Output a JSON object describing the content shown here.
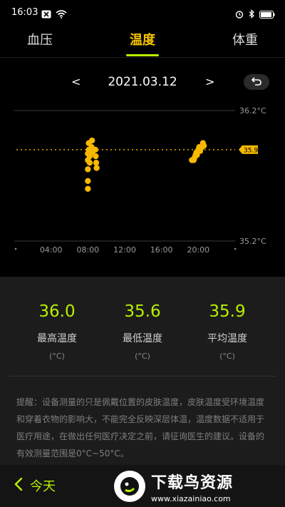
{
  "status_bar": {
    "time": "16:03"
  },
  "tabs": [
    {
      "label": "血压",
      "active": false
    },
    {
      "label": "温度",
      "active": true
    },
    {
      "label": "体重",
      "active": false
    }
  ],
  "date_nav": {
    "prev": "<",
    "date": "2021.03.12",
    "next": ">"
  },
  "chart_data": {
    "type": "scatter",
    "x_ticks": [
      "04:00",
      "08:00",
      "12:00",
      "16:00",
      "20:00"
    ],
    "y_max_label": "36.2°C",
    "y_min_label": "35.2°C",
    "ylim": [
      35.2,
      36.2
    ],
    "xlim": [
      0,
      24
    ],
    "average_label": "35.9",
    "average": 35.9,
    "accent_color": "#f6b800",
    "series": [
      {
        "points": [
          [
            8.0,
            35.75
          ],
          [
            8.0,
            35.66
          ],
          [
            8.0,
            35.6
          ],
          [
            8.0,
            35.82
          ],
          [
            8.0,
            35.87
          ],
          [
            8.1,
            35.9
          ],
          [
            8.1,
            35.95
          ],
          [
            8.2,
            35.85
          ],
          [
            8.2,
            35.8
          ],
          [
            8.4,
            35.92
          ],
          [
            8.45,
            35.97
          ],
          [
            8.5,
            35.88
          ],
          [
            8.8,
            35.9
          ],
          [
            8.85,
            35.85
          ],
          [
            8.9,
            35.8
          ],
          [
            8.95,
            35.76
          ],
          [
            19.3,
            35.82
          ],
          [
            19.5,
            35.82
          ],
          [
            19.6,
            35.84
          ],
          [
            19.7,
            35.86
          ],
          [
            19.8,
            35.88
          ],
          [
            19.85,
            35.86
          ],
          [
            20.0,
            35.9
          ],
          [
            20.1,
            35.92
          ],
          [
            20.2,
            35.89
          ],
          [
            20.4,
            35.92
          ],
          [
            20.5,
            35.95
          ],
          [
            20.6,
            35.93
          ]
        ]
      }
    ]
  },
  "stats": [
    {
      "value": "36.0",
      "label": "最高温度",
      "unit": "(°C)"
    },
    {
      "value": "35.6",
      "label": "最低温度",
      "unit": "(°C)"
    },
    {
      "value": "35.9",
      "label": "平均温度",
      "unit": "(°C)"
    }
  ],
  "notice": "提醒：设备测量的只是佩戴位置的皮肤温度，皮肤温度受环境温度和穿着衣物的影响大，不能完全反映深层体温，温度数据不适用于医疗用途，在做出任何医疗决定之前，请征询医生的建议。设备的有效测量范围是0°C~50°C。",
  "bottom_bar": {
    "today_label": "今天"
  },
  "watermark": {
    "title": "下载鸟资源",
    "url": "www.xiazainiao.com"
  }
}
